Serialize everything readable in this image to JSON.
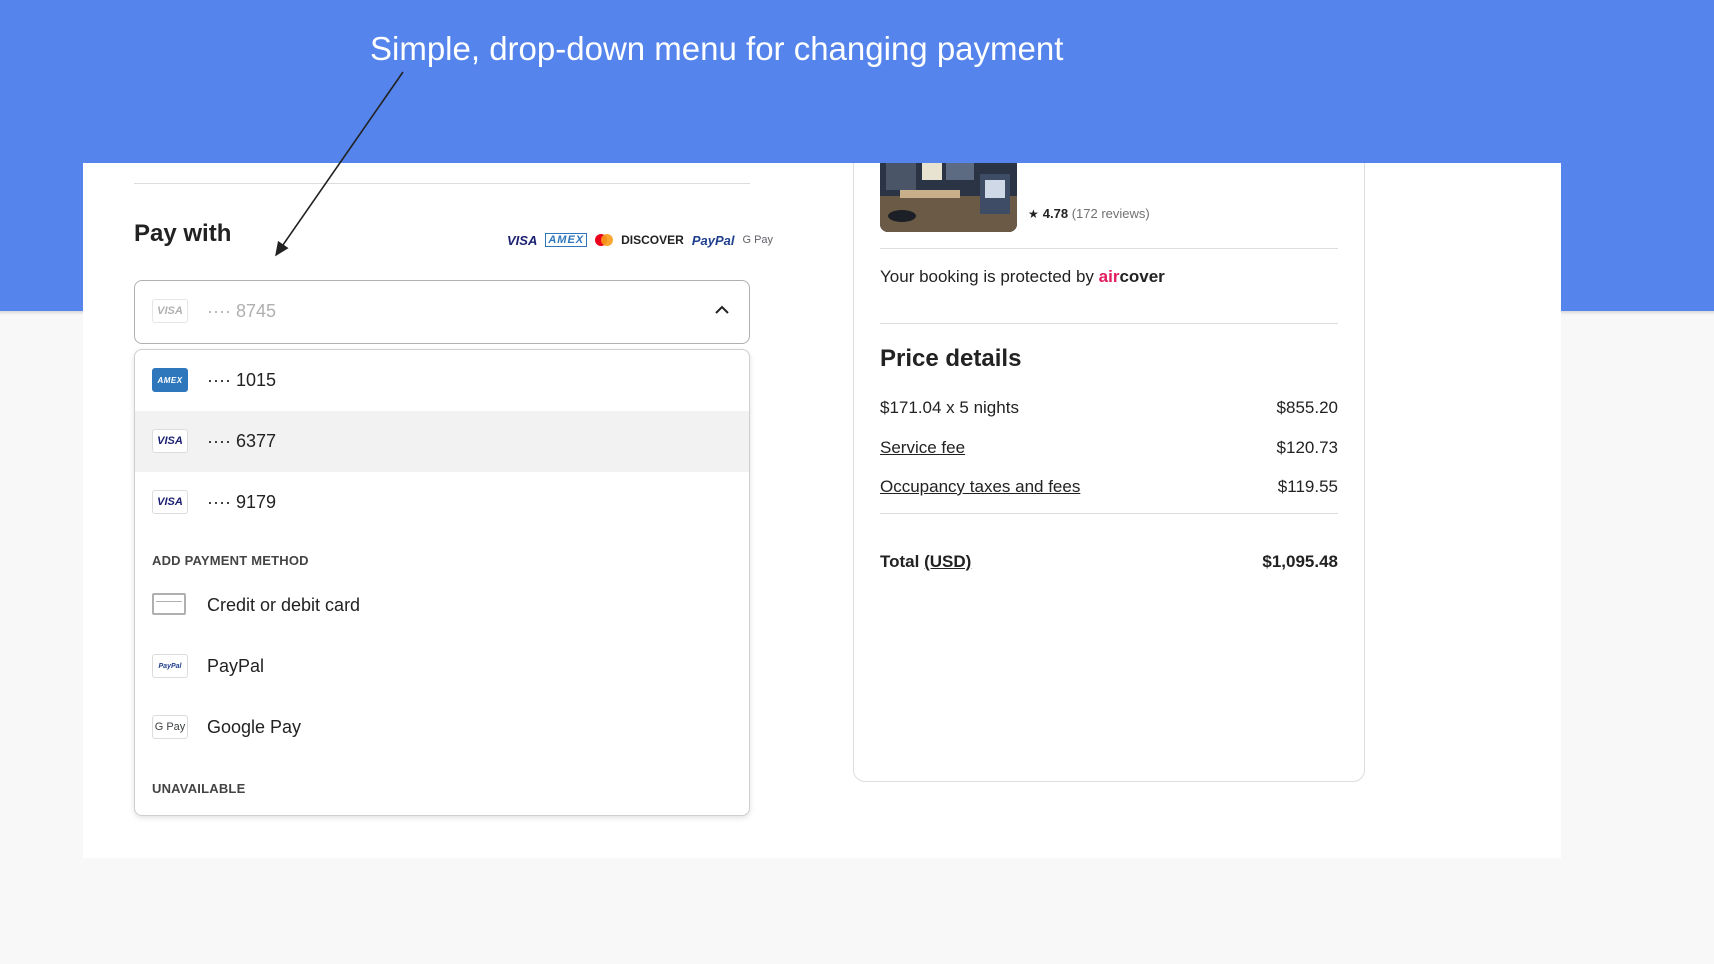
{
  "annotation": {
    "text": "Simple, drop-down menu for changing payment"
  },
  "payment": {
    "title": "Pay with",
    "brands": {
      "visa": "VISA",
      "amex": "AMEX",
      "discover": "DISCOVER",
      "paypal": "PayPal",
      "gpay": "G Pay"
    },
    "selected": {
      "icon": "visa-card-icon",
      "icon_label": "VISA",
      "value": "···· 8745"
    },
    "options": [
      {
        "icon": "amex-card-icon",
        "icon_label": "AMEX",
        "label": "···· 1015"
      },
      {
        "icon": "visa-card-icon",
        "icon_label": "VISA",
        "label": "···· 6377"
      },
      {
        "icon": "visa-card-icon",
        "icon_label": "VISA",
        "label": "···· 9179"
      }
    ],
    "add_section_label": "ADD PAYMENT METHOD",
    "add_methods": [
      {
        "icon": "credit-card-icon",
        "icon_label": "",
        "label": "Credit or debit card"
      },
      {
        "icon": "paypal-icon",
        "icon_label": "PayPal",
        "label": "PayPal"
      },
      {
        "icon": "google-pay-icon",
        "icon_label": "G Pay",
        "label": "Google Pay"
      }
    ],
    "unavailable_label": "UNAVAILABLE"
  },
  "listing": {
    "rating": "4.78",
    "reviews": "(172 reviews)",
    "protected_text": "Your booking is protected by",
    "aircover_air": "air",
    "aircover_cover": "cover"
  },
  "price": {
    "title": "Price details",
    "rows": [
      {
        "label": "$171.04 x 5 nights",
        "amount": "$855.20"
      },
      {
        "label": "Service fee",
        "amount": "$120.73"
      },
      {
        "label": "Occupancy taxes and fees",
        "amount": "$119.55"
      }
    ],
    "total_label": "Total",
    "total_currency": "(USD)",
    "total_amount": "$1,095.48"
  },
  "colors": {
    "banner": "#5484ec",
    "aircover_accent": "#e31c5f",
    "hover_row": "#f2f2f2"
  }
}
